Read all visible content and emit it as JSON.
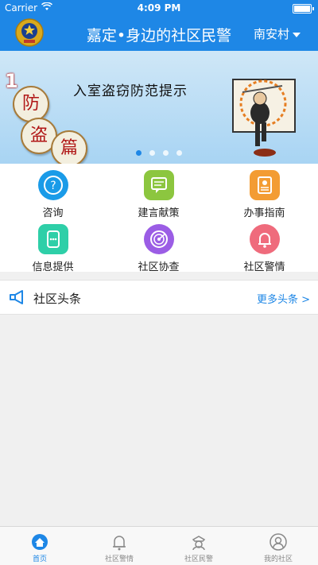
{
  "status_bar": {
    "carrier": "Carrier",
    "time": "4:09 PM"
  },
  "header": {
    "title": "嘉定•身边的社区民警",
    "location": "南安村"
  },
  "banner": {
    "headline": "入室盗窃防范提示",
    "badge_number": "1",
    "chips": [
      "防",
      "盗",
      "篇"
    ],
    "slide_count": 4,
    "active_slide": 1
  },
  "menu": {
    "items": [
      {
        "label": "咨询",
        "icon": "question-icon",
        "color": "#1a9be8"
      },
      {
        "label": "建言献策",
        "icon": "message-icon",
        "color": "#8cc63f"
      },
      {
        "label": "办事指南",
        "icon": "document-icon",
        "color": "#f39c33"
      },
      {
        "label": "信息提供",
        "icon": "chat-icon",
        "color": "#2ecfa8"
      },
      {
        "label": "社区协查",
        "icon": "radar-icon",
        "color": "#9b5de5"
      },
      {
        "label": "社区警情",
        "icon": "bell-icon",
        "color": "#ef6b7c"
      }
    ]
  },
  "headlines": {
    "label": "社区头条",
    "more": "更多头条 >"
  },
  "tabbar": {
    "active_color": "#1e87e6",
    "items": [
      {
        "label": "首页",
        "icon": "home-icon",
        "active": true
      },
      {
        "label": "社区警情",
        "icon": "bell-icon",
        "active": false
      },
      {
        "label": "社区民警",
        "icon": "police-icon",
        "active": false
      },
      {
        "label": "我的社区",
        "icon": "profile-icon",
        "active": false
      }
    ]
  }
}
